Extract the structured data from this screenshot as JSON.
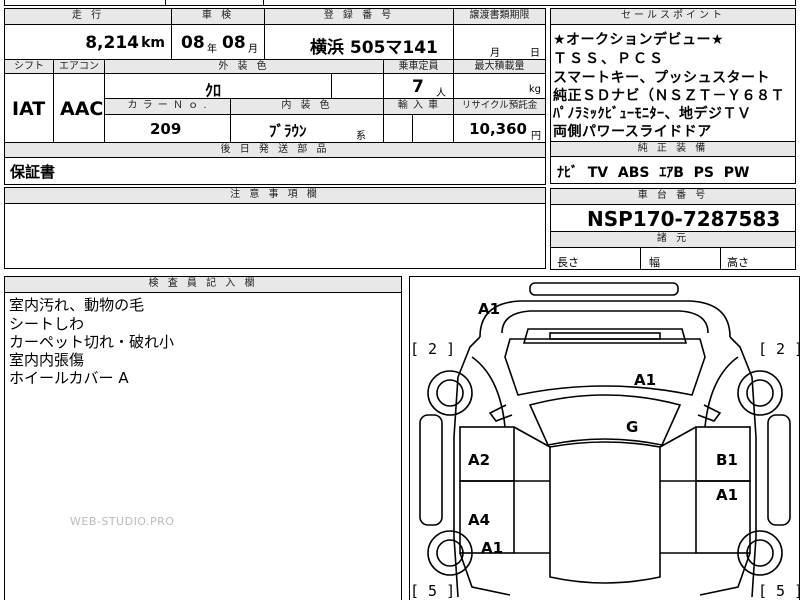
{
  "header_row": {
    "mileage_label": "走 行",
    "inspection_label": "車 検",
    "registration_label": "登 録 番 号",
    "transfer_label": "譲渡書類期限",
    "selling_points_label": "セールスポイント"
  },
  "mileage": {
    "value": "8,214",
    "unit": "km"
  },
  "inspection": {
    "year": "08",
    "year_unit": "年",
    "month": "08",
    "month_unit": "月"
  },
  "registration": {
    "number": "横浜 505マ141"
  },
  "transfer": {
    "month_unit": "月",
    "day_unit": "日"
  },
  "selling_points": [
    "★オークションデビュー★",
    "ＴＳＳ、ＰＣＳ",
    "スマートキー、プッシュスタート",
    "純正ＳＤナビ（ＮＳＺＴ－Ｙ６８Ｔ",
    "ﾊﾟﾉﾗﾐｯｸﾋﾞｭｰﾓﾆﾀｰ、地デジＴＶ",
    "両側パワースライドドア"
  ],
  "row2": {
    "shift_label": "シフト",
    "aircon_label": "エアコン",
    "exterior_label": "外 装 色",
    "capacity_label": "乗車定員",
    "max_load_label": "最大積載量"
  },
  "shift": "IAT",
  "aircon": "AAC",
  "exterior_color": "ｸﾛ",
  "capacity": {
    "value": "7",
    "unit": "人"
  },
  "max_load": {
    "unit": "kg"
  },
  "row3": {
    "color_no_label": "カ ラ ー Ｎ ｏ .",
    "interior_label": "内 装 色",
    "import_label": "輸 入 車",
    "recycle_label": "リサイクル預託金"
  },
  "color_no": "209",
  "interior": {
    "value": "ﾌﾞﾗｳﾝ",
    "suffix": "系"
  },
  "recycle": {
    "value": "10,360",
    "unit": "円"
  },
  "genuine_equipment": {
    "label": "純 正 装 備",
    "value": "ﾅﾋﾞ  TV  ABS  ｴｱB  PS  PW"
  },
  "later_parts": {
    "label": "後 日 発 送 部 品",
    "value": "保証書"
  },
  "notes": {
    "label": "注 意 事 項 欄"
  },
  "chassis": {
    "label": "車 台 番 号",
    "value": "NSP170-7287583"
  },
  "dimensions": {
    "label": "諸 元",
    "length": "長さ",
    "width": "幅",
    "height": "高さ"
  },
  "inspector": {
    "label": "検 査 員 記 入 欄",
    "lines": [
      "室内汚れ、動物の毛",
      "シートしわ",
      "カーペット切れ・破れ小",
      "室内内張傷",
      "ホイールカバー A"
    ]
  },
  "diagram_marks": {
    "front_bumper": "A1",
    "hood": "A1",
    "windshield": "G",
    "left_front_door": "A2",
    "right_front_door": "B1",
    "right_rear_door": "A1",
    "left_rear_door": "A4",
    "left_rear_fender": "A1",
    "front_left_tire": "[ 2 ]",
    "front_right_tire": "[ 2 ]",
    "rear_left_tire": "[ 5 ]",
    "rear_right_tire": "[ 5 ]"
  },
  "watermark": "WEB-STUDIO.PRO"
}
